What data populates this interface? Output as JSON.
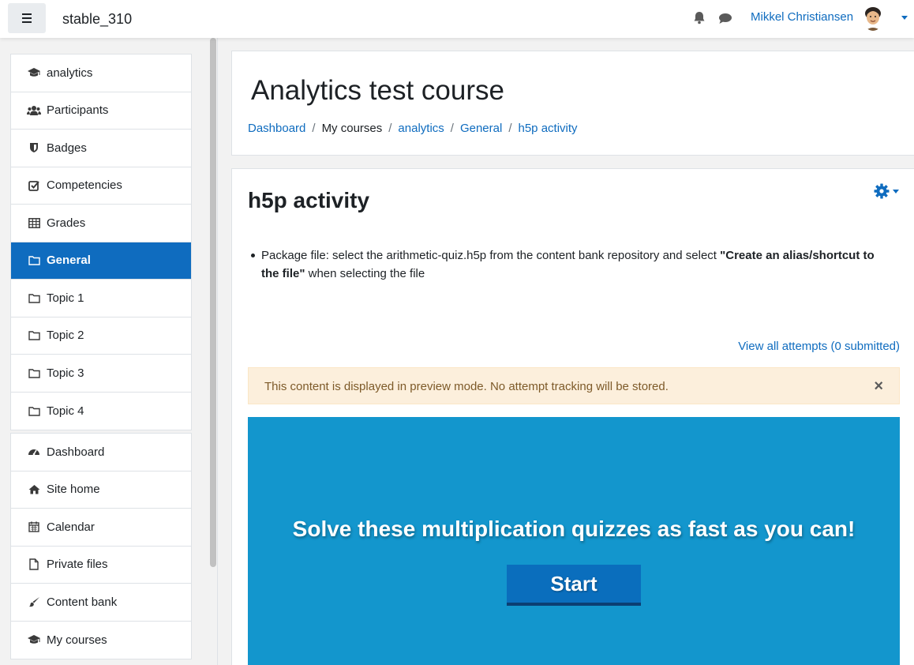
{
  "navbar": {
    "site_name": "stable_310",
    "user_name": "Mikkel Christiansen",
    "icons": [
      "menu-icon",
      "bell-icon",
      "chat-icon"
    ]
  },
  "drawer": {
    "course_items": [
      {
        "label": "analytics",
        "icon": "graduation-cap-icon"
      },
      {
        "label": "Participants",
        "icon": "users-icon"
      },
      {
        "label": "Badges",
        "icon": "shield-icon"
      },
      {
        "label": "Competencies",
        "icon": "check-square-icon"
      },
      {
        "label": "Grades",
        "icon": "table-icon"
      },
      {
        "label": "General",
        "icon": "folder-icon",
        "active": true
      },
      {
        "label": "Topic 1",
        "icon": "folder-icon"
      },
      {
        "label": "Topic 2",
        "icon": "folder-icon"
      },
      {
        "label": "Topic 3",
        "icon": "folder-icon"
      },
      {
        "label": "Topic 4",
        "icon": "folder-icon"
      }
    ],
    "site_items": [
      {
        "label": "Dashboard",
        "icon": "dashboard-icon"
      },
      {
        "label": "Site home",
        "icon": "home-icon"
      },
      {
        "label": "Calendar",
        "icon": "calendar-icon"
      },
      {
        "label": "Private files",
        "icon": "file-icon"
      },
      {
        "label": "Content bank",
        "icon": "paintbrush-icon"
      },
      {
        "label": "My courses",
        "icon": "graduation-cap-icon"
      }
    ]
  },
  "header": {
    "title": "Analytics test course",
    "breadcrumb": [
      "Dashboard",
      "My courses",
      "analytics",
      "General",
      "h5p activity"
    ]
  },
  "activity": {
    "title": "h5p activity",
    "intro_prefix": "Package file: select the arithmetic-quiz.h5p from the content bank repository and select ",
    "intro_bold": "\"Create an alias/shortcut to the file\"",
    "intro_suffix": " when selecting the file",
    "view_attempts": "View all attempts (0 submitted)",
    "alert": "This content is displayed in preview mode. No attempt tracking will be stored.",
    "alert_close": "×"
  },
  "h5p": {
    "heading": "Solve these multiplication quizzes as fast as you can!",
    "start_label": "Start",
    "background": "#1396cd"
  },
  "colors": {
    "accent": "#0f6cbf",
    "alert_bg": "#fcefdc"
  }
}
